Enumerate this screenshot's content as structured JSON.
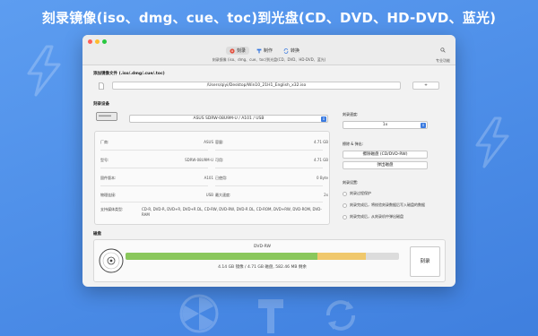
{
  "headline": "刻录镜像(iso、dmg、cue、toc)到光盘(CD、DVD、HD-DVD、蓝光)",
  "window": {
    "tabs": [
      {
        "label": "刻录",
        "icon": "disc-icon",
        "active": true
      },
      {
        "label": "制作",
        "icon": "hammer-icon",
        "active": false
      },
      {
        "label": "转换",
        "icon": "convert-icon",
        "active": false
      }
    ],
    "subtitle": "刻录镜像 (iso、dmg、cue、toc)到光盘(CD、DVD、HD-DVD、蓝光)",
    "help_label": "专业功能"
  },
  "image_section": {
    "title": "添加镜像文件 (.iso/.dmg/.cue/.toc)",
    "path": "/Users/qiyi/Desktop/Win10_21H1_English_x32.iso",
    "add_button": "+"
  },
  "device_section": {
    "title": "刻录设备",
    "drive": "ASUS SDRW-08U9M-U / A101 / USB",
    "info_left": [
      {
        "key": "厂商:",
        "value": "ASUS"
      },
      {
        "key": "型号:",
        "value": "SDRW-08U9M-U"
      },
      {
        "key": "固件版本:",
        "value": "A101"
      },
      {
        "key": "物理连接:",
        "value": "USB"
      }
    ],
    "info_right": [
      {
        "key": "容量:",
        "value": "4.71 GB"
      },
      {
        "key": "可用:",
        "value": "4.71 GB"
      },
      {
        "key": "已使用:",
        "value": "0 Byte"
      },
      {
        "key": "最大速度:",
        "value": "2x"
      }
    ],
    "supported_key": "支持媒体类型:",
    "supported_value": "CD-R, DVD-R, DVD+R, DVD+R DL, CD-RW, DVD-RW, DVD-R DL, CD-ROM, DVD+RW, DVD-ROM, DVD-RAM"
  },
  "speed_section": {
    "title": "刻录速度:",
    "value": "1x"
  },
  "erase_section": {
    "title": "擦除 & 弹出:",
    "erase_button": "擦除磁盘 (CD/DVD-RW)",
    "eject_button": "弹出磁盘"
  },
  "options_section": {
    "title": "刻录设置:",
    "options": [
      "刻录过程保护",
      "刻录完成后，将校验刻录数据后写入磁盘的数据",
      "刻录完成后，从刻录机中弹出磁盘"
    ]
  },
  "disk_section": {
    "title": "磁盘",
    "media": "DVD-RW",
    "summary": "4.14 GB 镜像 / 4.71 GB 磁盘, 582.46 MB 剩余",
    "image_fraction": 0.879,
    "burn_button": "刻录",
    "colors": {
      "used": "#8ac75c",
      "free": "#f0c86c",
      "empty": "#dcdcdc"
    }
  }
}
